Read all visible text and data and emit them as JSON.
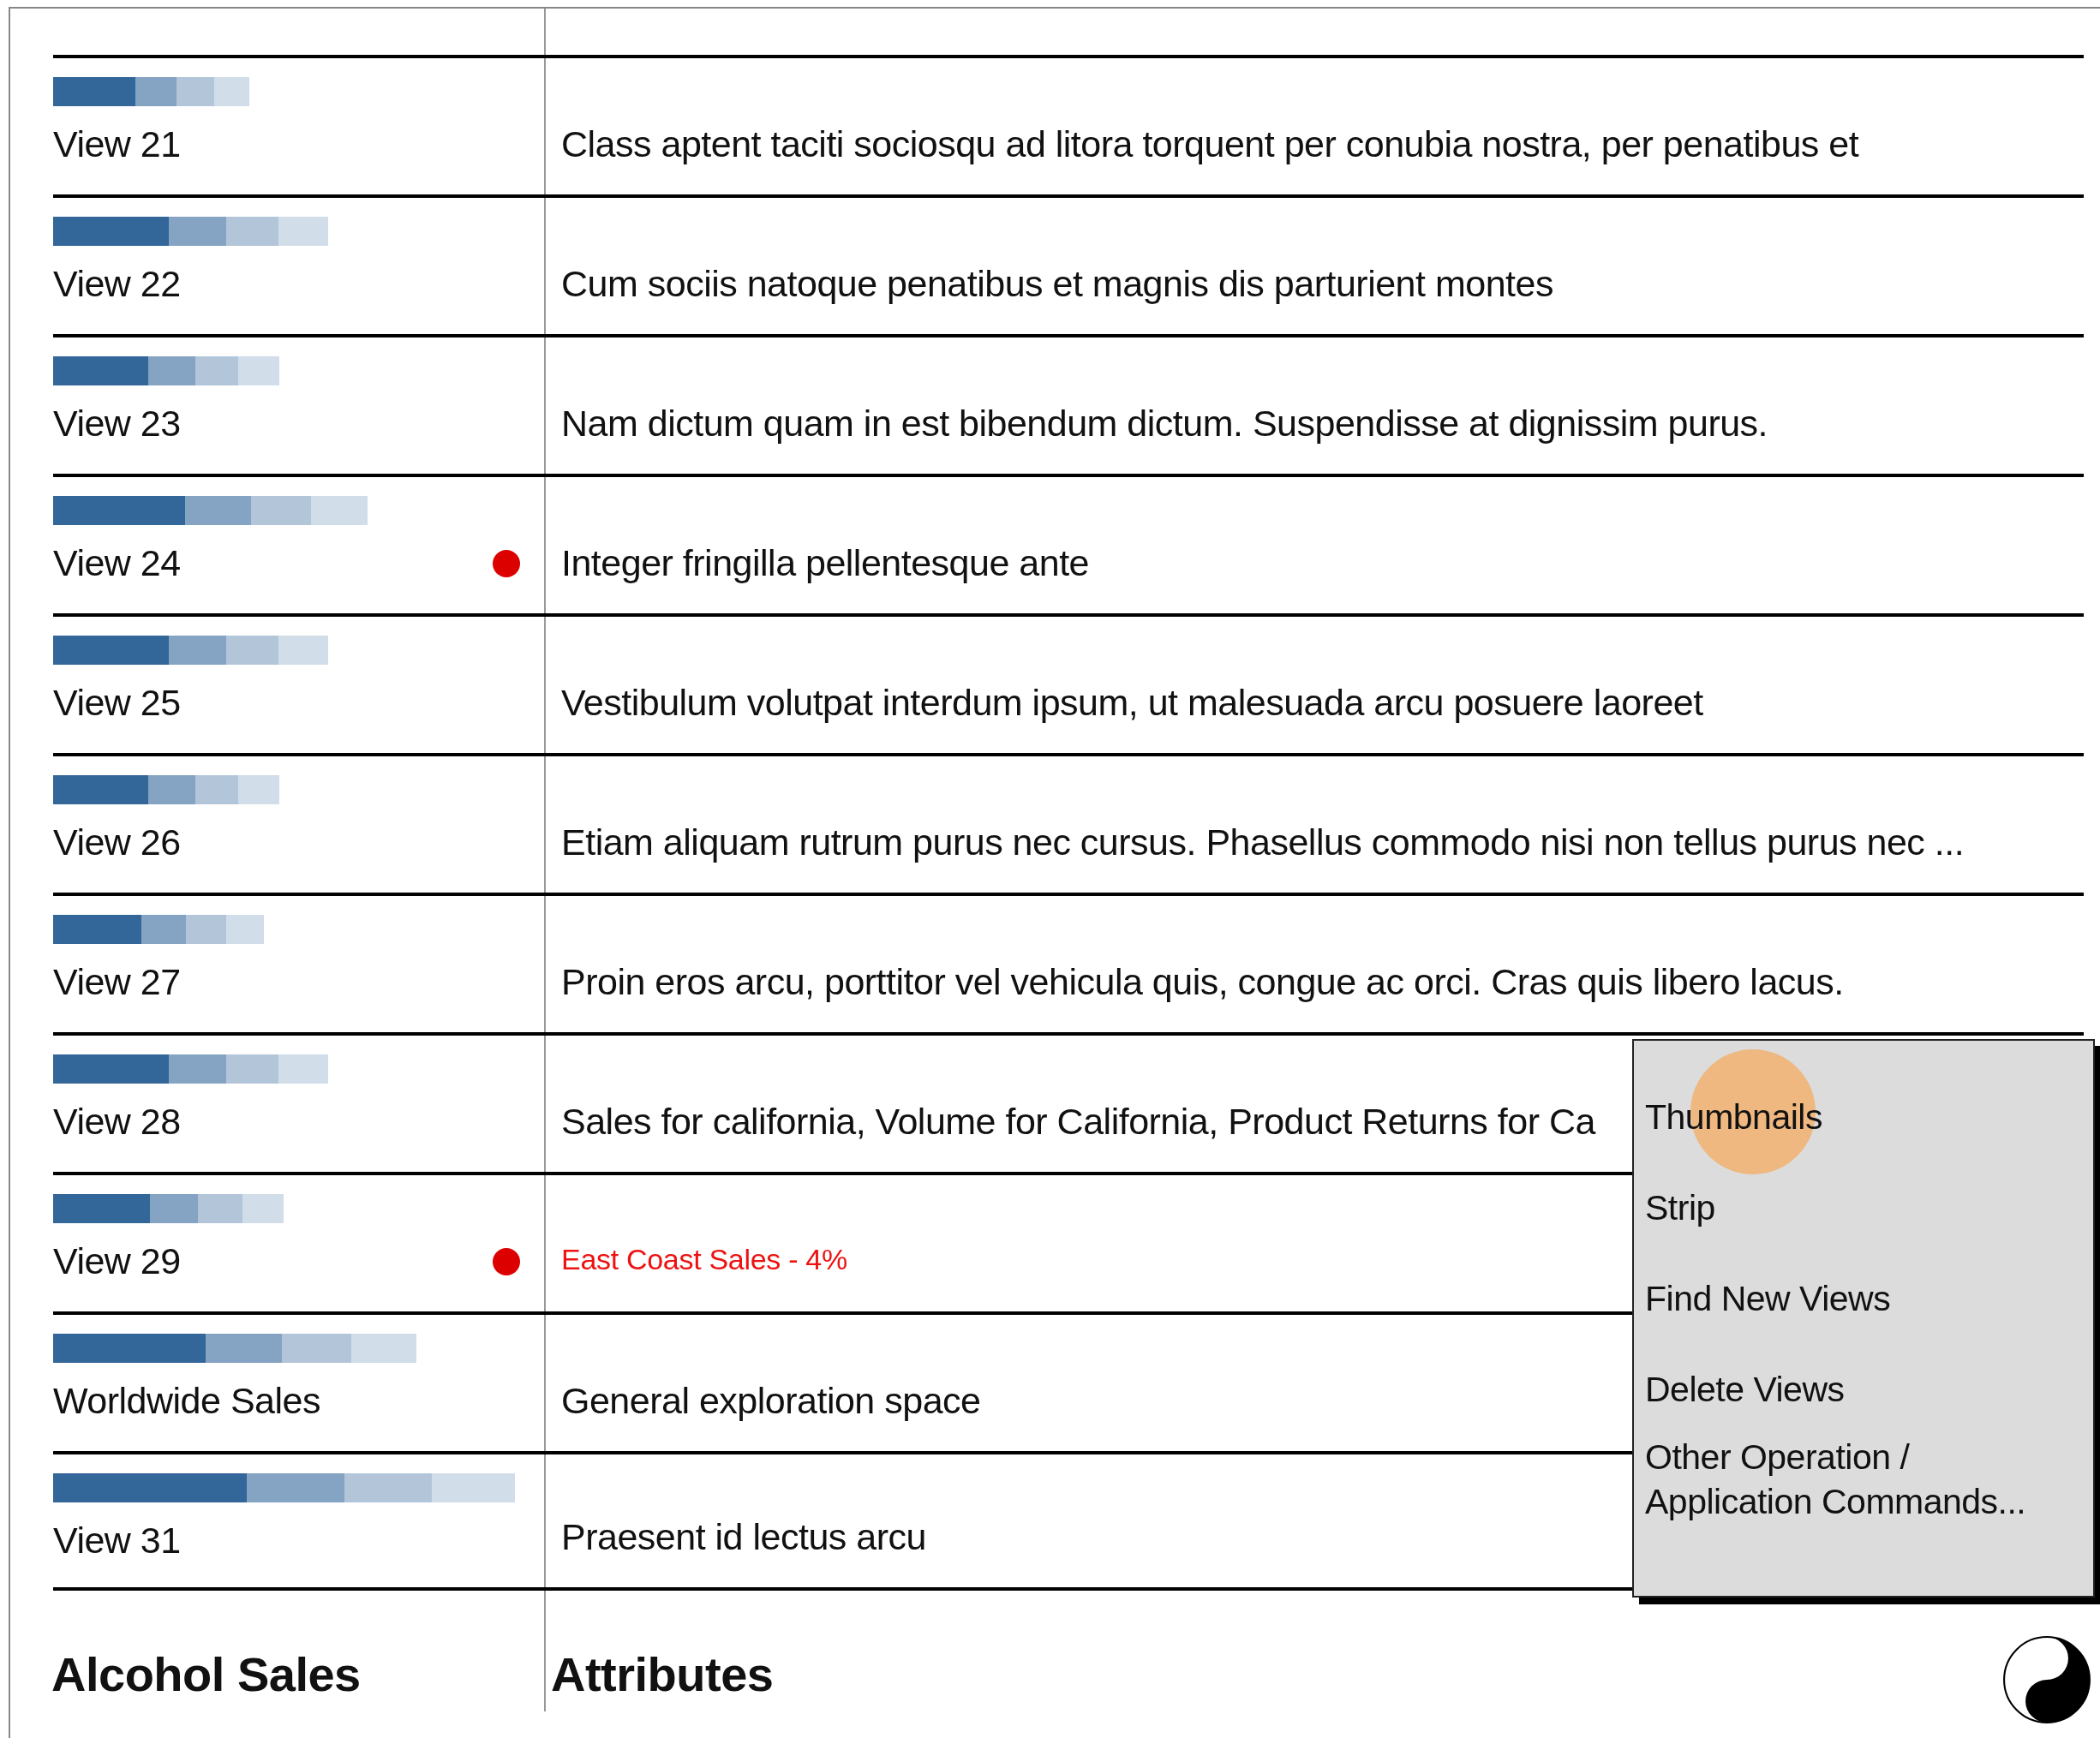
{
  "rows": [
    {
      "label": "View 21",
      "level": 0.4,
      "flagged": false,
      "description": "Class aptent taciti sociosqu ad litora torquent per conubia nostra, per penatibus et",
      "alert": false
    },
    {
      "label": "View 22",
      "level": 0.56,
      "flagged": false,
      "description": "Cum sociis natoque penatibus et magnis dis parturient montes",
      "alert": false
    },
    {
      "label": "View 23",
      "level": 0.46,
      "flagged": false,
      "description": "Nam dictum quam in est bibendum dictum. Suspendisse at dignissim purus.",
      "alert": false
    },
    {
      "label": "View 24",
      "level": 0.64,
      "flagged": true,
      "description": "Integer fringilla pellentesque ante",
      "alert": false
    },
    {
      "label": "View 25",
      "level": 0.56,
      "flagged": false,
      "description": "Vestibulum volutpat interdum ipsum, ut malesuada arcu posuere laoreet",
      "alert": false
    },
    {
      "label": "View 26",
      "level": 0.46,
      "flagged": false,
      "description": "Etiam aliquam rutrum purus nec cursus. Phasellus commodo nisi non tellus purus nec ...",
      "alert": false
    },
    {
      "label": "View 27",
      "level": 0.43,
      "flagged": false,
      "description": "Proin eros arcu, porttitor vel vehicula quis, congue ac orci. Cras quis libero lacus.",
      "alert": false
    },
    {
      "label": "View 28",
      "level": 0.56,
      "flagged": false,
      "description": "Sales for california, Volume for California, Product Returns for Ca",
      "alert": false
    },
    {
      "label": "View 29",
      "level": 0.47,
      "flagged": true,
      "description": "East Coast Sales - 4%",
      "alert": true
    },
    {
      "label": "Worldwide Sales",
      "level": 0.74,
      "flagged": false,
      "description": "General exploration space",
      "alert": false
    },
    {
      "label": "View 31",
      "level": 0.94,
      "flagged": false,
      "description": "Praesent id lectus arcu",
      "alert": false
    }
  ],
  "context_menu": {
    "items": [
      {
        "label": "Thumbnails",
        "touched": true
      },
      {
        "label": "Strip",
        "touched": false
      },
      {
        "label": "Find New Views",
        "touched": false
      },
      {
        "label": "Delete Views",
        "touched": false
      },
      {
        "label": "Other Operation / Application Commands...",
        "touched": false
      }
    ]
  },
  "footer": {
    "left_heading": "Alcohol Sales",
    "right_heading": "Attributes"
  }
}
